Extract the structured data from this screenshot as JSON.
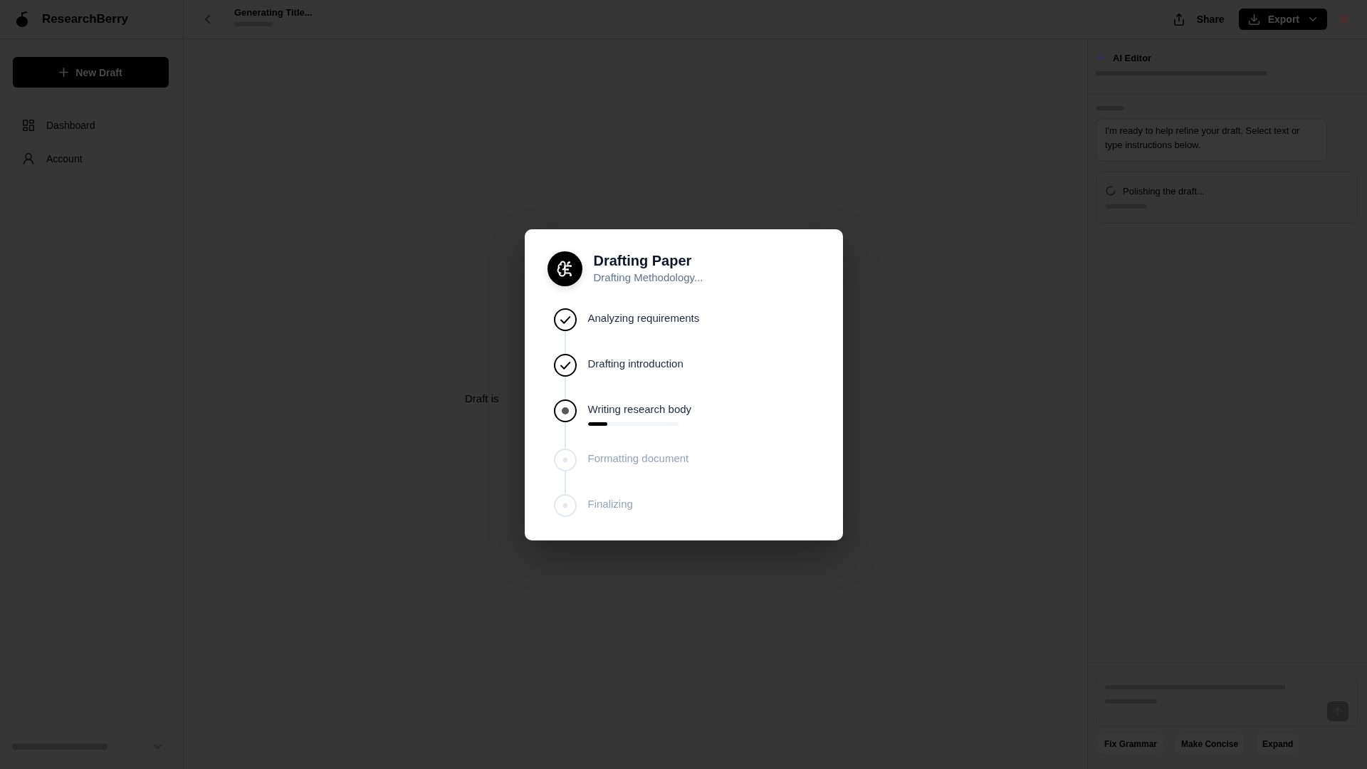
{
  "sidebar": {
    "brand": "ResearchBerry",
    "new_draft_button": "New Draft",
    "items": [
      {
        "label": "Dashboard",
        "selected": false
      },
      {
        "label": "Account",
        "selected": false
      }
    ]
  },
  "topbar": {
    "title": "Generating Title...",
    "buttons": [
      {
        "label": "Share",
        "kind": "ghost"
      },
      {
        "label": "Export",
        "kind": "primary"
      }
    ]
  },
  "editor": {
    "status_text": "Draft is"
  },
  "ai_panel": {
    "title": "AI Editor",
    "message": "I'm ready to help refine your draft. Select text or type instructions below.",
    "activity": "Polishing the draft...",
    "quick_actions": [
      "Fix Grammar",
      "Make Concise",
      "Expand"
    ]
  },
  "modal": {
    "title": "Drafting Paper",
    "subtitle": "Drafting Methodology...",
    "steps": [
      {
        "label": "Analyzing requirements",
        "completed": true,
        "active": false
      },
      {
        "label": "Drafting introduction",
        "completed": true,
        "active": false
      },
      {
        "label": "Writing research body",
        "completed": false,
        "active": true,
        "level": 0.22
      },
      {
        "label": "Formatting document",
        "completed": false,
        "active": false
      },
      {
        "label": "Finalizing",
        "completed": false,
        "active": false
      }
    ]
  }
}
